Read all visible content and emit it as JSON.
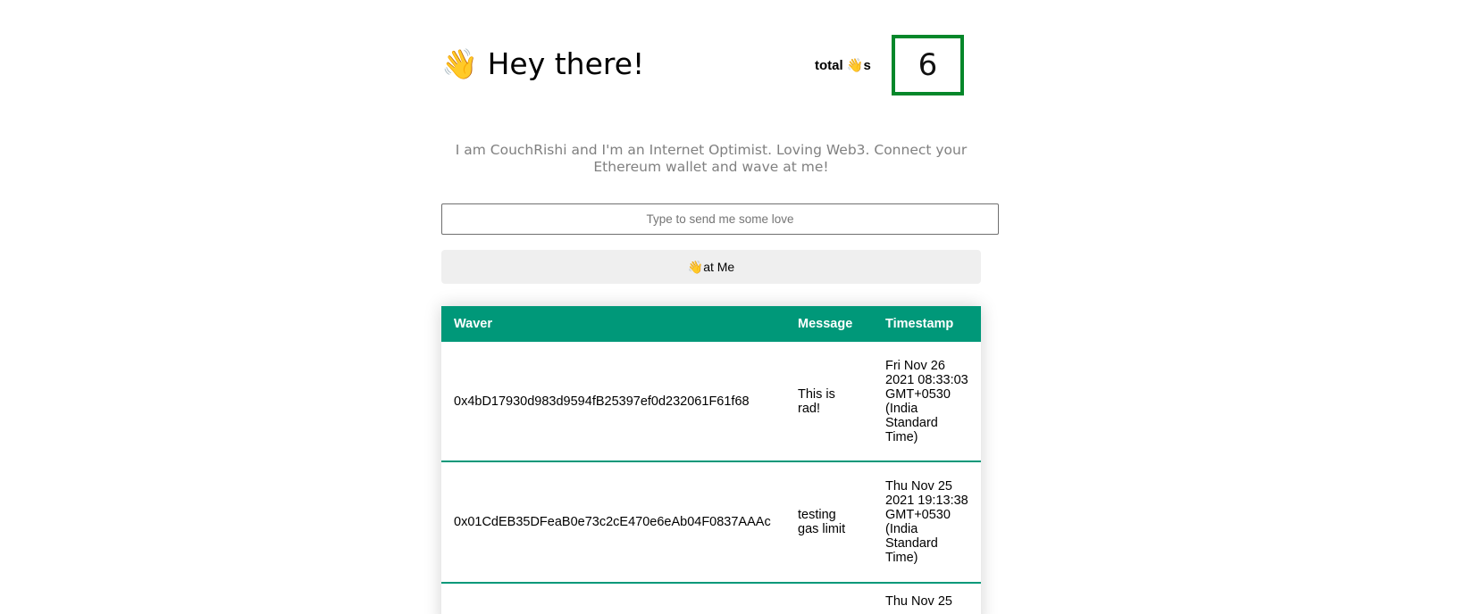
{
  "header": {
    "title": "👋 Hey there!",
    "total_label": "total 👋s",
    "total_count": "6"
  },
  "bio": "I am CouchRishi and I'm an Internet Optimist. Loving Web3. Connect your Ethereum wallet and wave at me!",
  "message_input": {
    "value": "",
    "placeholder": "Type to send me some love"
  },
  "wave_button": {
    "label": "👋at Me"
  },
  "waves_table": {
    "headers": {
      "waver": "Waver",
      "message": "Message",
      "timestamp": "Timestamp"
    },
    "rows": [
      {
        "waver": "0x4bD17930d983d9594fB25397ef0d232061F61f68",
        "message": "This is rad!",
        "timestamp": "Fri Nov 26 2021 08:33:03 GMT+0530 (India Standard Time)"
      },
      {
        "waver": "0x01CdEB35DFeaB0e73c2cE470e6eAb04F0837AAAc",
        "message": "testing gas limit",
        "timestamp": "Thu Nov 25 2021 19:13:38 GMT+0530 (India Standard Time)"
      },
      {
        "waver": "",
        "message": "",
        "timestamp": "Thu Nov 25"
      }
    ]
  },
  "colors": {
    "accent": "#009879",
    "count_border": "#05872a",
    "bio_text": "#808080",
    "button_bg": "#efefef"
  }
}
